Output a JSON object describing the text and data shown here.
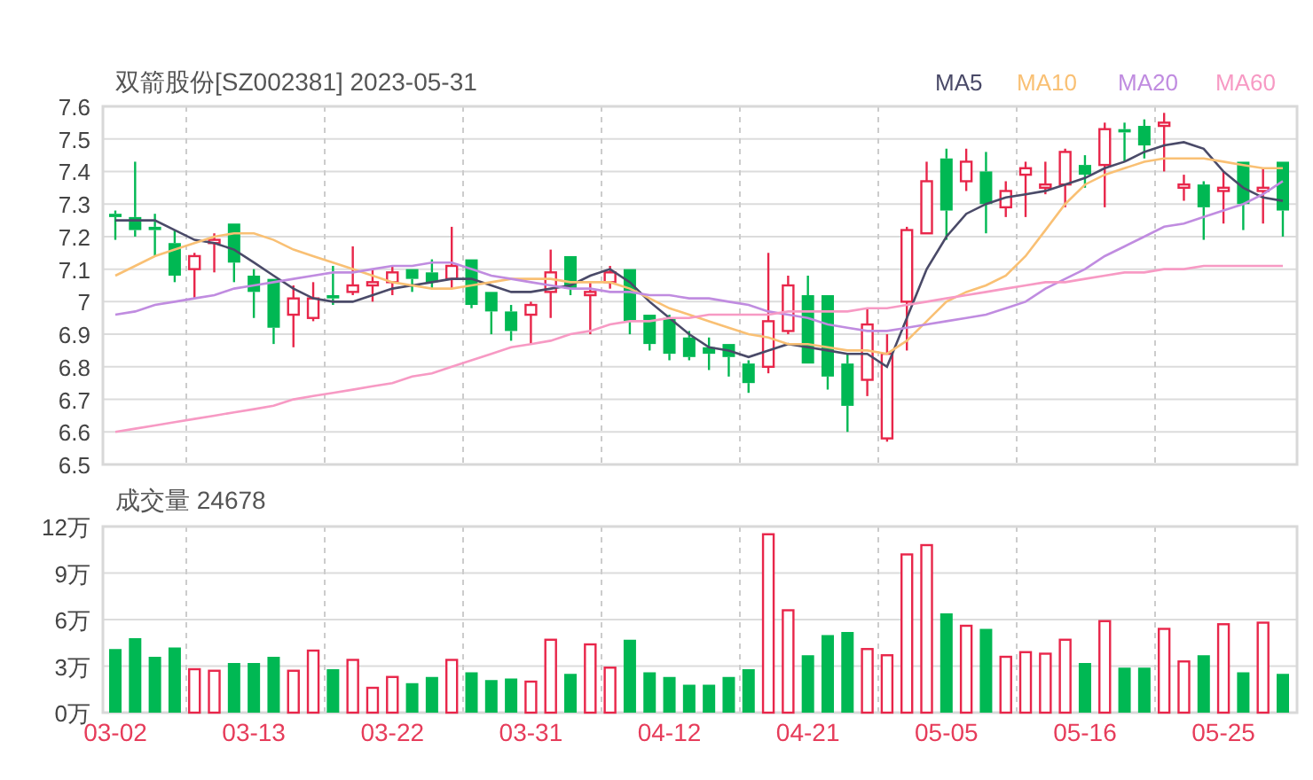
{
  "price_chart": {
    "chart_data": {
      "type": "candlestick",
      "title": "双箭股份[SZ002381] 2023-05-31",
      "grid": true,
      "ylim": [
        6.5,
        7.6
      ],
      "yticks": [
        7.6,
        7.5,
        7.4,
        7.3,
        7.2,
        7.1,
        7,
        6.9,
        6.8,
        6.7,
        6.6,
        6.5
      ],
      "ohlc": [
        [
          7.27,
          7.28,
          7.19,
          7.26
        ],
        [
          7.26,
          7.43,
          7.2,
          7.22
        ],
        [
          7.23,
          7.27,
          7.14,
          7.22
        ],
        [
          7.18,
          7.22,
          7.06,
          7.08
        ],
        [
          7.1,
          7.15,
          7.01,
          7.14
        ],
        [
          7.18,
          7.21,
          7.09,
          7.19
        ],
        [
          7.24,
          7.24,
          7.06,
          7.12
        ],
        [
          7.08,
          7.1,
          6.95,
          7.03
        ],
        [
          7.07,
          7.07,
          6.87,
          6.92
        ],
        [
          6.96,
          7.05,
          6.86,
          7.01
        ],
        [
          6.95,
          7.06,
          6.94,
          7.01
        ],
        [
          7.02,
          7.11,
          6.99,
          7.01
        ],
        [
          7.03,
          7.17,
          7.02,
          7.05
        ],
        [
          7.05,
          7.1,
          7.0,
          7.06
        ],
        [
          7.06,
          7.11,
          7.02,
          7.09
        ],
        [
          7.1,
          7.1,
          7.03,
          7.07
        ],
        [
          7.09,
          7.13,
          7.04,
          7.06
        ],
        [
          7.07,
          7.23,
          7.04,
          7.11
        ],
        [
          7.13,
          7.13,
          6.98,
          6.99
        ],
        [
          7.03,
          7.03,
          6.9,
          6.97
        ],
        [
          6.97,
          6.99,
          6.88,
          6.91
        ],
        [
          6.96,
          7.0,
          6.87,
          6.99
        ],
        [
          7.03,
          7.16,
          6.95,
          7.09
        ],
        [
          7.14,
          7.14,
          7.02,
          7.04
        ],
        [
          7.02,
          7.06,
          6.9,
          7.03
        ],
        [
          7.06,
          7.11,
          7.04,
          7.09
        ],
        [
          7.1,
          7.1,
          6.9,
          6.94
        ],
        [
          6.96,
          6.96,
          6.85,
          6.87
        ],
        [
          6.95,
          6.96,
          6.82,
          6.84
        ],
        [
          6.89,
          6.91,
          6.82,
          6.83
        ],
        [
          6.86,
          6.89,
          6.79,
          6.84
        ],
        [
          6.87,
          6.87,
          6.77,
          6.83
        ],
        [
          6.81,
          6.82,
          6.72,
          6.75
        ],
        [
          6.8,
          7.15,
          6.78,
          6.94
        ],
        [
          6.91,
          7.08,
          6.9,
          7.05
        ],
        [
          7.02,
          7.08,
          6.81,
          6.81
        ],
        [
          7.02,
          7.02,
          6.73,
          6.77
        ],
        [
          6.81,
          6.84,
          6.6,
          6.68
        ],
        [
          6.76,
          6.98,
          6.71,
          6.93
        ],
        [
          6.58,
          6.9,
          6.57,
          6.84
        ],
        [
          7.0,
          7.23,
          6.85,
          7.22
        ],
        [
          7.21,
          7.43,
          7.21,
          7.37
        ],
        [
          7.44,
          7.47,
          7.19,
          7.28
        ],
        [
          7.37,
          7.47,
          7.34,
          7.43
        ],
        [
          7.4,
          7.46,
          7.21,
          7.3
        ],
        [
          7.29,
          7.37,
          7.26,
          7.34
        ],
        [
          7.39,
          7.43,
          7.26,
          7.41
        ],
        [
          7.35,
          7.43,
          7.33,
          7.36
        ],
        [
          7.36,
          7.47,
          7.29,
          7.46
        ],
        [
          7.42,
          7.45,
          7.35,
          7.39
        ],
        [
          7.42,
          7.55,
          7.29,
          7.53
        ],
        [
          7.53,
          7.55,
          7.43,
          7.52
        ],
        [
          7.54,
          7.56,
          7.44,
          7.48
        ],
        [
          7.54,
          7.58,
          7.4,
          7.55
        ],
        [
          7.35,
          7.39,
          7.31,
          7.36
        ],
        [
          7.36,
          7.37,
          7.19,
          7.29
        ],
        [
          7.34,
          7.4,
          7.24,
          7.35
        ],
        [
          7.43,
          7.43,
          7.22,
          7.3
        ],
        [
          7.34,
          7.41,
          7.24,
          7.35
        ],
        [
          7.43,
          7.43,
          7.2,
          7.28
        ]
      ],
      "series": [
        {
          "name": "MA5",
          "type": "line",
          "color": "#4a4a68",
          "values": [
            7.25,
            7.25,
            7.25,
            7.22,
            7.19,
            7.18,
            7.16,
            7.12,
            7.08,
            7.04,
            7.01,
            7.0,
            7.0,
            7.02,
            7.04,
            7.05,
            7.06,
            7.07,
            7.07,
            7.05,
            7.03,
            7.03,
            7.04,
            7.05,
            7.08,
            7.1,
            7.06,
            7.0,
            6.95,
            6.9,
            6.86,
            6.85,
            6.83,
            6.85,
            6.87,
            6.86,
            6.85,
            6.84,
            6.84,
            6.8,
            6.95,
            7.1,
            7.2,
            7.27,
            7.3,
            7.32,
            7.33,
            7.34,
            7.36,
            7.38,
            7.41,
            7.43,
            7.46,
            7.48,
            7.49,
            7.47,
            7.4,
            7.35,
            7.32,
            7.31
          ]
        },
        {
          "name": "MA10",
          "type": "line",
          "color": "#f9c074",
          "values": [
            7.08,
            7.11,
            7.14,
            7.16,
            7.18,
            7.2,
            7.21,
            7.21,
            7.19,
            7.16,
            7.14,
            7.12,
            7.1,
            7.08,
            7.06,
            7.05,
            7.04,
            7.04,
            7.05,
            7.06,
            7.07,
            7.07,
            7.07,
            7.06,
            7.06,
            7.06,
            7.04,
            7.01,
            6.98,
            6.96,
            6.94,
            6.92,
            6.9,
            6.89,
            6.87,
            6.87,
            6.86,
            6.85,
            6.85,
            6.84,
            6.88,
            6.94,
            7.0,
            7.03,
            7.05,
            7.08,
            7.14,
            7.22,
            7.3,
            7.36,
            7.39,
            7.41,
            7.43,
            7.44,
            7.44,
            7.44,
            7.43,
            7.42,
            7.41,
            7.41
          ]
        },
        {
          "name": "MA20",
          "type": "line",
          "color": "#c08ce0",
          "values": [
            6.96,
            6.97,
            6.99,
            7.0,
            7.01,
            7.02,
            7.04,
            7.05,
            7.06,
            7.07,
            7.08,
            7.09,
            7.09,
            7.1,
            7.11,
            7.11,
            7.12,
            7.12,
            7.1,
            7.08,
            7.07,
            7.06,
            7.05,
            7.04,
            7.04,
            7.03,
            7.03,
            7.02,
            7.02,
            7.01,
            7.01,
            7.0,
            6.99,
            6.97,
            6.96,
            6.95,
            6.93,
            6.92,
            6.91,
            6.91,
            6.92,
            6.93,
            6.94,
            6.95,
            6.96,
            6.98,
            7.0,
            7.04,
            7.07,
            7.1,
            7.14,
            7.17,
            7.2,
            7.23,
            7.24,
            7.26,
            7.28,
            7.3,
            7.33,
            7.37
          ]
        },
        {
          "name": "MA60",
          "type": "line",
          "color": "#f79ac4",
          "values": [
            6.6,
            6.61,
            6.62,
            6.63,
            6.64,
            6.65,
            6.66,
            6.67,
            6.68,
            6.7,
            6.71,
            6.72,
            6.73,
            6.74,
            6.75,
            6.77,
            6.78,
            6.8,
            6.82,
            6.84,
            6.86,
            6.87,
            6.88,
            6.9,
            6.91,
            6.93,
            6.94,
            6.94,
            6.95,
            6.95,
            6.96,
            6.96,
            6.96,
            6.96,
            6.97,
            6.97,
            6.97,
            6.97,
            6.98,
            6.98,
            6.99,
            7.0,
            7.01,
            7.02,
            7.03,
            7.04,
            7.05,
            7.06,
            7.06,
            7.07,
            7.08,
            7.09,
            7.09,
            7.1,
            7.1,
            7.11,
            7.11,
            7.11,
            7.11,
            7.11
          ]
        }
      ]
    }
  },
  "volume_chart": {
    "chart_data": {
      "type": "bar",
      "title": "成交量 24678",
      "grid": true,
      "ylim": [
        0,
        12
      ],
      "yticks": [
        {
          "value": 12,
          "label": "12万"
        },
        {
          "value": 9,
          "label": "9万"
        },
        {
          "value": 6,
          "label": "6万"
        },
        {
          "value": 3,
          "label": "3万"
        },
        {
          "value": 0,
          "label": "0万"
        }
      ],
      "categories": [
        "03-02",
        null,
        null,
        null,
        null,
        null,
        null,
        "03-13",
        null,
        null,
        null,
        null,
        null,
        null,
        "03-22",
        null,
        null,
        null,
        null,
        null,
        null,
        "03-31",
        null,
        null,
        null,
        null,
        null,
        null,
        "04-12",
        null,
        null,
        null,
        null,
        null,
        null,
        "04-21",
        null,
        null,
        null,
        null,
        null,
        null,
        "05-05",
        null,
        null,
        null,
        null,
        null,
        null,
        "05-16",
        null,
        null,
        null,
        null,
        null,
        null,
        "05-25",
        null,
        null,
        null
      ],
      "values": [
        4.1,
        4.8,
        3.6,
        4.2,
        2.8,
        2.7,
        3.2,
        3.2,
        3.6,
        2.7,
        4.0,
        2.8,
        3.4,
        1.6,
        2.3,
        1.9,
        2.3,
        3.4,
        2.6,
        2.1,
        2.2,
        2.0,
        4.7,
        2.5,
        4.4,
        2.9,
        4.7,
        2.6,
        2.3,
        1.8,
        1.8,
        2.3,
        2.8,
        11.5,
        6.6,
        3.7,
        5.0,
        5.2,
        4.1,
        3.7,
        10.2,
        10.8,
        6.4,
        5.6,
        5.4,
        3.6,
        3.9,
        3.8,
        4.7,
        3.2,
        5.9,
        2.9,
        2.9,
        5.4,
        3.3,
        3.7,
        5.7,
        2.6,
        5.8,
        2.5
      ]
    }
  }
}
